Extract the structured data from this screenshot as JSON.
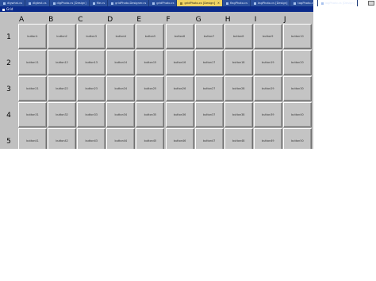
{
  "tabs": [
    {
      "label": "dlgwhst.cs",
      "active": false
    },
    {
      "label": "dlgtest.cs",
      "active": false
    },
    {
      "label": "dlgPhoto.cs [Design]",
      "active": false
    },
    {
      "label": "file.cs",
      "active": false
    },
    {
      "label": "gridPhoto.Designer.cs",
      "active": false
    },
    {
      "label": "gridPhoto.cs",
      "active": false
    },
    {
      "label": "gridPhoto.cs [Design]",
      "active": true
    },
    {
      "label": "flagPhoto.cs",
      "active": false
    },
    {
      "label": "tagPhoto.cs [Design]",
      "active": false
    },
    {
      "label": "tagPhoto.cs",
      "active": false
    },
    {
      "label": "tagPhoto.cs [Design]",
      "active": false
    }
  ],
  "tab_close": "✕",
  "window": {
    "title": "Grid"
  },
  "columns": [
    "A",
    "B",
    "C",
    "D",
    "E",
    "F",
    "G",
    "H",
    "I",
    "J"
  ],
  "rows": [
    "1",
    "2",
    "3",
    "4",
    "5"
  ],
  "buttons": [
    [
      "button1",
      "button2",
      "button3",
      "button4",
      "button5",
      "button6",
      "button7",
      "button8",
      "button9",
      "button10"
    ],
    [
      "button11",
      "button12",
      "button13",
      "button14",
      "button15",
      "button16",
      "button17",
      "button18",
      "button19",
      "button20"
    ],
    [
      "button21",
      "button22",
      "button23",
      "button24",
      "button25",
      "button26",
      "button27",
      "button28",
      "button29",
      "button30"
    ],
    [
      "button31",
      "button32",
      "button33",
      "button34",
      "button35",
      "button36",
      "button37",
      "button38",
      "button39",
      "button40"
    ],
    [
      "button41",
      "button42",
      "button43",
      "button44",
      "button45",
      "button46",
      "button47",
      "button48",
      "button49",
      "button50"
    ]
  ],
  "colors": {
    "tabbar": "#2a4f9c",
    "active_tab": "#f0d463",
    "titlebar": "#0a2a8a",
    "form": "#c0c0c0"
  }
}
